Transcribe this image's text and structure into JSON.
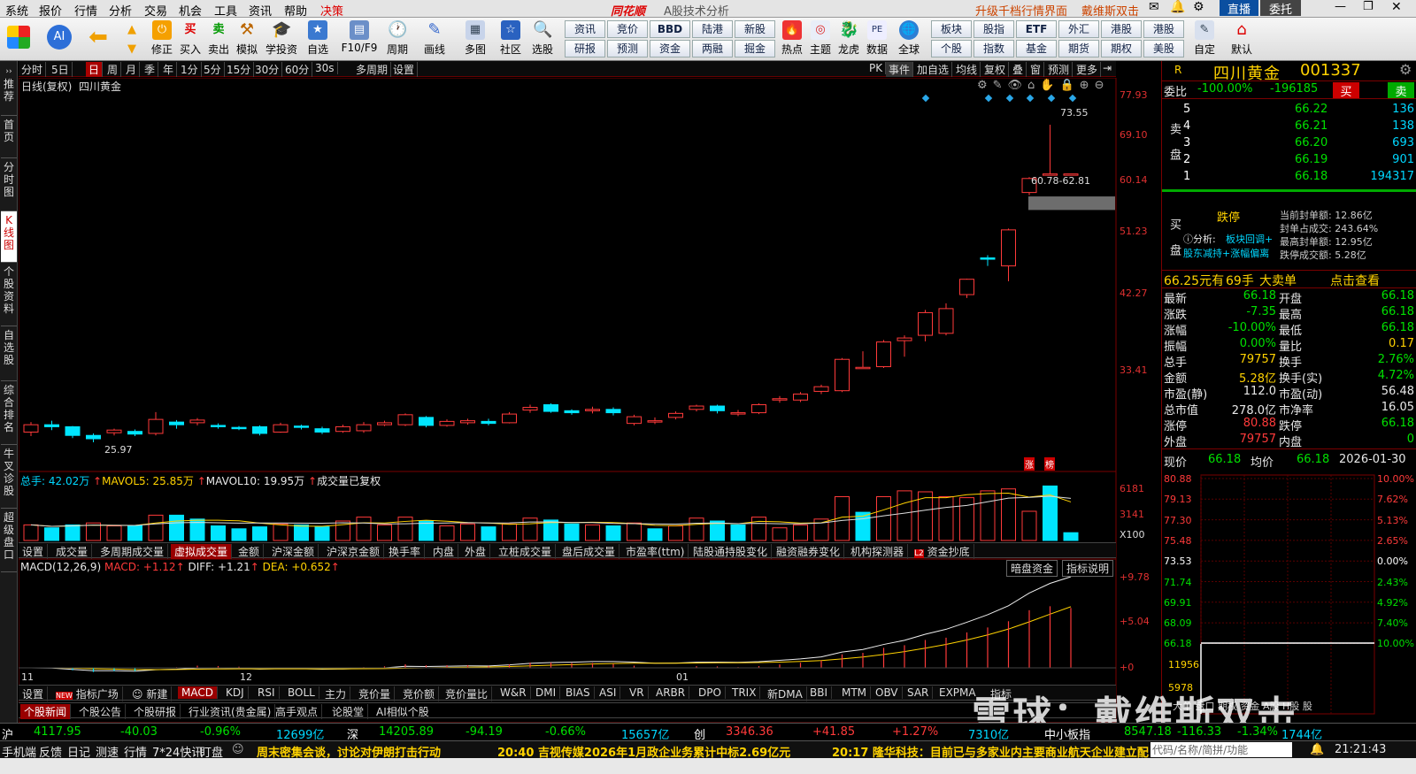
{
  "menu": {
    "items": [
      "系统",
      "报价",
      "行情",
      "分析",
      "交易",
      "机会",
      "工具",
      "资讯",
      "帮助",
      "决策"
    ],
    "brand": "同花顺",
    "subtitle": "A股技术分析",
    "promo1": "升级千档行情界面",
    "promo2": "戴维斯双击",
    "btn_live": "直播",
    "btn_entrust": "委托"
  },
  "toolbar": {
    "buttons": [
      "修正",
      "买入",
      "卖出",
      "模拟",
      "学投资",
      "自选",
      "F10/F9",
      "周期",
      "画线",
      "多图",
      "社区",
      "选股"
    ],
    "grid": [
      [
        "资讯",
        "竞价",
        "BBD",
        "陆港",
        "新股"
      ],
      [
        "研报",
        "预测",
        "资金",
        "两融",
        "掘金"
      ]
    ],
    "buttons2": [
      "热点",
      "主题",
      "龙虎",
      "数据",
      "全球"
    ],
    "grid2": [
      [
        "板块",
        "股指",
        "ETF",
        "外汇",
        "港股"
      ],
      [
        "个股",
        "指数",
        "基金",
        "期货",
        "期权",
        "美股"
      ]
    ],
    "buttons3": [
      "自定",
      "默认"
    ]
  },
  "lefttabs": [
    "推荐",
    "首页",
    "分时图",
    "K线图",
    "个股资料",
    "自选股",
    "综合排名",
    "牛叉诊股",
    "超级盘口"
  ],
  "periodbar": {
    "items": [
      "分时",
      "5日",
      "日",
      "周",
      "月",
      "季",
      "年",
      "1分",
      "5分",
      "15分",
      "30分",
      "60分",
      "30s",
      "多周期",
      "设置"
    ],
    "right": [
      "PK",
      "事件",
      "加自选",
      "均线",
      "复权",
      "叠",
      "窗",
      "预测",
      "更多"
    ]
  },
  "chart_header": {
    "mode": "日线(复权)",
    "name": "四川黄金"
  },
  "chart_data": {
    "type": "candlestick",
    "price_axis": [
      "77.93",
      "69.10",
      "60.14",
      "51.23",
      "42.27",
      "33.41"
    ],
    "annot_high": "73.55",
    "annot_low": "25.97",
    "annot_zone": "60.78-62.81",
    "x_labels": [
      "11",
      "12",
      "01"
    ],
    "candles": [
      [
        27.5,
        28.6,
        26.9,
        29.0
      ],
      [
        28.6,
        28.3,
        27.8,
        29.2
      ],
      [
        28.3,
        27.0,
        26.6,
        28.4
      ],
      [
        27.0,
        26.5,
        25.97,
        27.3
      ],
      [
        27.4,
        27.8,
        27.0,
        28.0
      ],
      [
        27.6,
        27.2,
        26.9,
        27.9
      ],
      [
        27.3,
        29.4,
        27.0,
        30.5
      ],
      [
        29.0,
        28.6,
        28.0,
        29.3
      ],
      [
        28.9,
        29.3,
        28.5,
        29.6
      ],
      [
        28.5,
        28.4,
        28.0,
        28.8
      ],
      [
        28.2,
        28.1,
        27.8,
        28.4
      ],
      [
        28.3,
        27.3,
        27.0,
        28.5
      ],
      [
        27.5,
        28.6,
        27.4,
        28.9
      ],
      [
        28.4,
        28.2,
        27.9,
        28.6
      ],
      [
        28.0,
        27.5,
        27.2,
        28.3
      ],
      [
        27.6,
        28.3,
        27.4,
        28.6
      ],
      [
        27.7,
        28.6,
        27.4,
        29.0
      ],
      [
        28.6,
        28.9,
        28.4,
        29.2
      ],
      [
        28.6,
        30.1,
        28.4,
        30.3
      ],
      [
        29.7,
        28.5,
        28.2,
        29.9
      ],
      [
        28.5,
        29.1,
        28.3,
        29.4
      ],
      [
        28.9,
        29.2,
        28.6,
        29.5
      ],
      [
        29.1,
        28.8,
        28.5,
        29.5
      ],
      [
        28.9,
        30.2,
        28.8,
        30.5
      ],
      [
        30.8,
        31.2,
        30.4,
        31.6
      ],
      [
        31.6,
        30.6,
        30.4,
        31.8
      ],
      [
        30.7,
        30.4,
        30.1,
        30.9
      ],
      [
        30.7,
        30.9,
        30.3,
        31.3
      ],
      [
        30.9,
        30.4,
        30.0,
        31.2
      ],
      [
        28.8,
        29.8,
        28.5,
        30.1
      ],
      [
        29.2,
        29.2,
        28.7,
        29.7
      ],
      [
        29.7,
        30.3,
        29.4,
        30.6
      ],
      [
        30.9,
        31.4,
        30.6,
        31.6
      ],
      [
        31.4,
        30.7,
        30.3,
        31.6
      ],
      [
        30.3,
        30.4,
        29.9,
        30.8
      ],
      [
        30.4,
        31.6,
        30.2,
        31.8
      ],
      [
        32.3,
        32.5,
        31.9,
        32.9
      ],
      [
        32.3,
        33.2,
        32.0,
        33.5
      ],
      [
        33.6,
        34.3,
        33.2,
        34.6
      ],
      [
        33.7,
        38.4,
        33.5,
        38.6
      ],
      [
        37.2,
        37.2,
        37.0,
        39.6
      ],
      [
        37.3,
        41.0,
        37.1,
        41.3
      ],
      [
        41.2,
        41.6,
        38.8,
        42.0
      ],
      [
        42.0,
        45.4,
        41.1,
        45.8
      ],
      [
        42.3,
        46.0,
        42.0,
        46.8
      ],
      [
        48.1,
        50.4,
        47.6,
        50.5
      ],
      [
        53.6,
        53.4,
        52.4,
        54.0
      ],
      [
        52.4,
        57.8,
        50.1,
        58.0
      ],
      [
        63.4,
        65.5,
        63.0,
        65.7
      ],
      [
        66.18,
        66.18,
        66.18,
        73.55
      ],
      [
        66.18,
        66.18,
        66.18,
        66.18
      ]
    ],
    "vol_header": {
      "total": "总手: 42.02万",
      "mavol5": "MAVOL5: 25.85万",
      "mavol10": "MAVOL10: 19.95万",
      "note": "成交量已复权"
    },
    "vol_axis": [
      "6181",
      "3141",
      "X100"
    ],
    "volumes": [
      1.6,
      1.3,
      1.6,
      1.8,
      1.5,
      1.5,
      2.6,
      2.6,
      2.2,
      1.5,
      1.2,
      1.4,
      1.7,
      1.6,
      1.4,
      2.0,
      2.4,
      1.6,
      2.4,
      2.0,
      1.5,
      1.7,
      1.4,
      1.7,
      2.3,
      2.1,
      1.7,
      1.6,
      1.5,
      1.8,
      1.2,
      1.5,
      2.3,
      2.0,
      1.6,
      2.4,
      1.3,
      1.6,
      2.2,
      4.5,
      2.9,
      4.5,
      5.1,
      5.0,
      4.5,
      4.4,
      5.1,
      5.3,
      3.0,
      5.6,
      0.8
    ],
    "vol_up": [
      1,
      0,
      0,
      1,
      1,
      0,
      1,
      0,
      0,
      0,
      0,
      0,
      1,
      0,
      0,
      1,
      1,
      1,
      1,
      0,
      1,
      1,
      0,
      1,
      1,
      0,
      0,
      1,
      0,
      1,
      0,
      1,
      1,
      0,
      0,
      1,
      1,
      1,
      1,
      1,
      0,
      1,
      1,
      1,
      1,
      1,
      1,
      1,
      1,
      0,
      0
    ],
    "macd_header": {
      "name": "MACD(12,26,9)",
      "macd": "MACD: +1.12",
      "diff": "DIFF: +1.21",
      "dea": "DEA: +0.652"
    },
    "macd_axis": [
      "+9.78",
      "+5.04",
      "+0"
    ]
  },
  "vol_tabs": [
    "设置",
    "成交量",
    "多周期成交量",
    "虚拟成交量",
    "金额",
    "沪深金额",
    "沪深京金额",
    "换手率",
    "内盘",
    "外盘",
    "立桩成交量",
    "盘后成交量",
    "市盈率(ttm)",
    "陆股通持股变化",
    "融资融券变化",
    "机构探测器",
    "资金抄底"
  ],
  "macd_buttons": [
    "暗盘资金",
    "指标说明"
  ],
  "ind_tabs": [
    "设置",
    "指标广场",
    "新建",
    "MACD",
    "KDJ",
    "RSI",
    "BOLL",
    "主力",
    "竞价量",
    "竞价额",
    "竞价量比",
    "W&R",
    "DMI",
    "BIAS",
    "ASI",
    "VR",
    "ARBR",
    "DPO",
    "TRIX",
    "新DMA",
    "BBI",
    "MTM",
    "OBV",
    "SAR",
    "EXPMA",
    "指标"
  ],
  "news_tabs": [
    "个股新闻",
    "个股公告",
    "个股研报",
    "行业资讯(贵金属)",
    "高手观点",
    "论股堂",
    "AI相似个股"
  ],
  "stock": {
    "market": "R",
    "name": "四川黄金",
    "code": "001337",
    "weibi_label": "委比",
    "weibi": "-100.00%",
    "weicha": "-196185",
    "buy_btn": "买",
    "sell_btn": "卖",
    "sell_side": "卖盘",
    "buy_side": "买盘",
    "asks": [
      [
        "5",
        "66.22",
        "136"
      ],
      [
        "4",
        "66.21",
        "138"
      ],
      [
        "3",
        "66.20",
        "693"
      ],
      [
        "2",
        "66.19",
        "901"
      ],
      [
        "1",
        "66.18",
        "194317"
      ]
    ],
    "limit_status": "跌停",
    "analysis_label": "分析:",
    "analysis1": "板块回调+",
    "analysis2": "股东减持+涨幅偏离",
    "seal_lines": [
      "当前封单额: 12.86亿",
      "封单占成交: 243.64%",
      "最高封单额: 12.95亿",
      "跌停成交额: 5.28亿"
    ],
    "big_order": "66.25元有",
    "big_order_hand": "69手",
    "big_order_label": "大卖单",
    "big_order_link": "点击查看",
    "stats": [
      [
        "最新",
        "66.18",
        "开盘",
        "66.18"
      ],
      [
        "涨跌",
        "-7.35",
        "最高",
        "66.18"
      ],
      [
        "涨幅",
        "-10.00%",
        "最低",
        "66.18"
      ],
      [
        "振幅",
        "0.00%",
        "量比",
        "0.17"
      ],
      [
        "总手",
        "79757",
        "换手",
        "2.76%"
      ],
      [
        "金额",
        "5.28亿",
        "换手(实)",
        "4.72%"
      ],
      [
        "市盈(静)",
        "112.0",
        "市盈(动)",
        "56.48"
      ],
      [
        "总市值",
        "278.0亿",
        "市净率",
        "16.05"
      ],
      [
        "涨停",
        "80.88",
        "跌停",
        "66.18"
      ],
      [
        "外盘",
        "79757",
        "内盘",
        "0"
      ]
    ],
    "mini_header": {
      "now_label": "现价",
      "now": "66.18",
      "avg_label": "均价",
      "avg": "66.18",
      "date": "2026-01-30"
    },
    "mini_left": [
      "80.88",
      "79.13",
      "77.30",
      "75.48",
      "73.53",
      "71.74",
      "69.91",
      "68.09",
      "66.18"
    ],
    "mini_right": [
      "10.00%",
      "7.62%",
      "5.13%",
      "2.65%",
      "0.00%",
      "2.43%",
      "4.92%",
      "7.40%",
      "10.00%"
    ],
    "mini_vol": [
      "11956",
      "5978"
    ],
    "tabs_bottom": [
      "大单",
      "盘口",
      "期权",
      "资金",
      "A股",
      "H股",
      "股"
    ]
  },
  "indices": [
    {
      "name": "沪",
      "value": "4117.95",
      "chg": "-40.03",
      "pct": "-0.96%",
      "amt": "12699亿"
    },
    {
      "name": "深",
      "value": "14205.89",
      "chg": "-94.19",
      "pct": "-0.66%",
      "amt": "15657亿"
    },
    {
      "name": "创",
      "value": "3346.36",
      "chg": "+41.85",
      "pct": "+1.27%",
      "amt": "7310亿"
    },
    {
      "name": "中小板指",
      "value": "8547.18",
      "chg": "-116.33",
      "pct": "-1.34%",
      "amt": "1744亿"
    }
  ],
  "statusbar": {
    "items": [
      "手机端",
      "反馈",
      "日记",
      "测速",
      "行情",
      "7*24快讯",
      "盯盘"
    ],
    "news1": "周末密集会谈，讨论对伊朗打击行动",
    "news2": "20:40 吉视传媒2026年1月政企业务累计中标2.69亿元",
    "news3": "20:17 隆华科技：目前已与多家业内主要商业航天企业建立配套",
    "search_placeholder": "代码/名称/简拼/功能",
    "clock": "21:21:43"
  },
  "watermark": "雪球：戴维斯双击",
  "colors": {
    "up": "#ff3a3a",
    "down": "#00e5ff",
    "bg": "#000000",
    "axis": "#7a0000"
  }
}
